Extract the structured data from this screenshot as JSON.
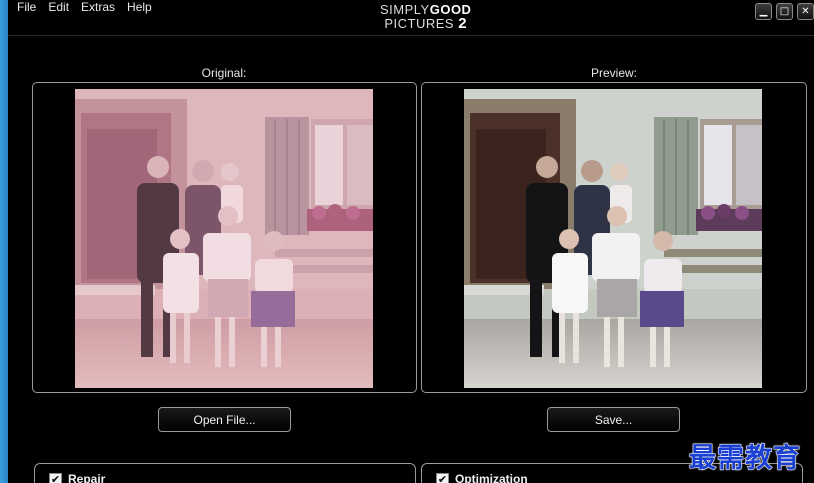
{
  "menu": [
    "File",
    "Edit",
    "Extras",
    "Help"
  ],
  "app_logo": {
    "line1_prefix": "SIMPLY",
    "line1_bold": "GOOD",
    "line2_prefix": "PICTURES",
    "line2_bold": "2"
  },
  "window_controls": [
    "minimize-icon",
    "maximize-icon",
    "close-icon"
  ],
  "panels": {
    "original": {
      "label": "Original:"
    },
    "preview": {
      "label": "Preview:"
    }
  },
  "buttons": {
    "open_file": "Open File...",
    "save": "Save..."
  },
  "groups": {
    "repair": {
      "label": "Repair",
      "checked": true
    },
    "optimization": {
      "label": "Optimization",
      "checked": true
    }
  },
  "watermark": "最需教育",
  "colors": {
    "background": "#000000",
    "border": "#9a9a9a",
    "watermark": "#1a3fd1",
    "window_edge": "#2b83c6"
  }
}
